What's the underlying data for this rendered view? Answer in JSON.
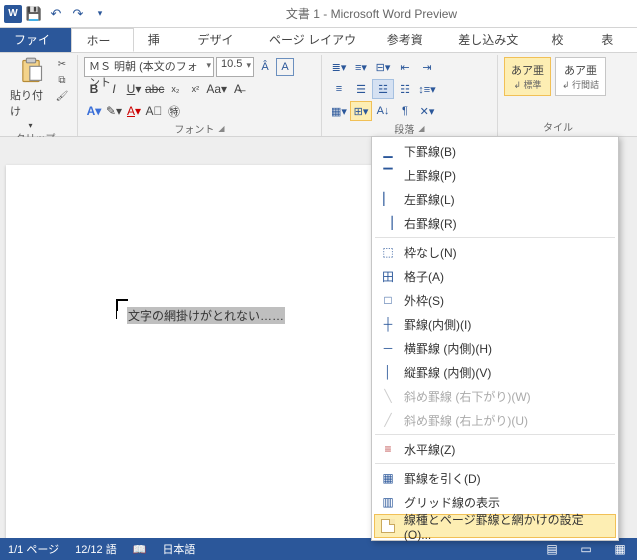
{
  "title": "文書 1 - Microsoft Word Preview",
  "tabs": {
    "file": "ファイル",
    "home": "ホーム",
    "insert": "挿入",
    "design": "デザイン",
    "layout": "ページ レイアウト",
    "references": "参考資料",
    "mailings": "差し込み文書",
    "review": "校閲",
    "view": "表示"
  },
  "clipboard": {
    "paste": "貼り付け",
    "label": "クリップボ…"
  },
  "font": {
    "name": "ＭＳ 明朝 (本文のフォント",
    "size": "10.5",
    "label": "フォント"
  },
  "para": {
    "label": "段落"
  },
  "styles": {
    "s1": "あア亜",
    "s1sub": "↲ 標準",
    "s2": "あア亜",
    "s2sub": "↲ 行間詰",
    "label": "タイル"
  },
  "doc": {
    "selected": "文字の網掛けがとれない……"
  },
  "menu": {
    "bottom": "下罫線(B)",
    "top": "上罫線(P)",
    "left": "左罫線(L)",
    "right": "右罫線(R)",
    "none": "枠なし(N)",
    "grid": "格子(A)",
    "outside": "外枠(S)",
    "insideAll": "罫線(内側)(I)",
    "insideH": "横罫線 (内側)(H)",
    "insideV": "縦罫線 (内側)(V)",
    "diagDown": "斜め罫線 (右下がり)(W)",
    "diagUp": "斜め罫線 (右上がり)(U)",
    "hr": "水平線(Z)",
    "draw": "罫線を引く(D)",
    "showGrid": "グリッド線の表示",
    "settings": "線種とページ罫線と網かけの設定(O)..."
  },
  "status": {
    "page": "1/1 ページ",
    "words": "12/12 語",
    "lang": "日本語"
  }
}
